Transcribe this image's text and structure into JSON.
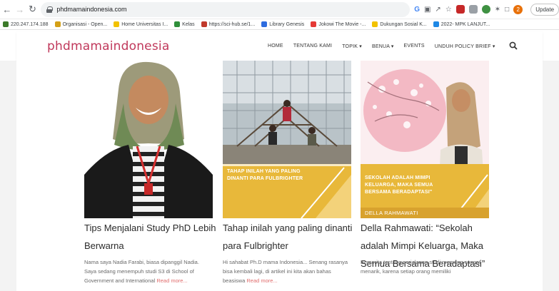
{
  "browser": {
    "url": "phdmamaindonesia.com",
    "update_label": "Update",
    "profile_initial": "2",
    "bookmarks": [
      {
        "label": "220.247.174.188",
        "color": "#3c7a2a"
      },
      {
        "label": "Organisasi - Open...",
        "color": "#d4a017"
      },
      {
        "label": "Home Universitas I...",
        "color": "#f2c200"
      },
      {
        "label": "Kelas",
        "color": "#2f8f3a"
      },
      {
        "label": "https://sci-hub.se/1...",
        "color": "#c0392b"
      },
      {
        "label": "Library Genesis",
        "color": "#2d6cdf"
      },
      {
        "label": "Jokowi The Movie -...",
        "color": "#e53935"
      },
      {
        "label": "Dukungan Sosial K...",
        "color": "#f2c200"
      },
      {
        "label": "2022- MPK LANJUT...",
        "color": "#1e88e5"
      }
    ]
  },
  "site": {
    "logo": "phdmamaindonesia",
    "menu": [
      "HOME",
      "TENTANG KAMI",
      "TOPIK ▾",
      "BENUA ▾",
      "EVENTS",
      "UNDUH POLICY BRIEF ▾"
    ],
    "accent_color": "#c0385b"
  },
  "cards": [
    {
      "title": "Tips Menjalani Study PhD Lebih Berwarna",
      "excerpt": "Nama saya Nadia Farabi, biasa dipanggil Nadia. Saya sedang menempuh studi S3 di School of Government and International",
      "read_more": "Read more..."
    },
    {
      "title": "Tahap inilah yang paling dinanti para Fulbrighter",
      "image_caption": "TAHAP INILAH YANG PALING DINANTI PARA FULBRIGHTER",
      "excerpt": "Hi sahabat Ph.D mama Indonesia... Senang rasanya bisa kembali lagi, di artikel ini kita akan bahas beasiswa",
      "read_more": "Read more..."
    },
    {
      "title": "Della Rahmawati: “Sekolah adalah Mimpi Keluarga, Maka Semua Bersama Beradaptasi”",
      "image_caption": "SEKOLAH ADALAH MIMPI KELUARGA, MAKA SEMUA BERSAMA BERADAPTASI\"",
      "image_author": "DELLA RAHMAWATI",
      "excerpt": "Bercerita tentang perjalanan studi memang sangat menarik, karena setiap orang memiliki",
      "read_more": ""
    }
  ]
}
